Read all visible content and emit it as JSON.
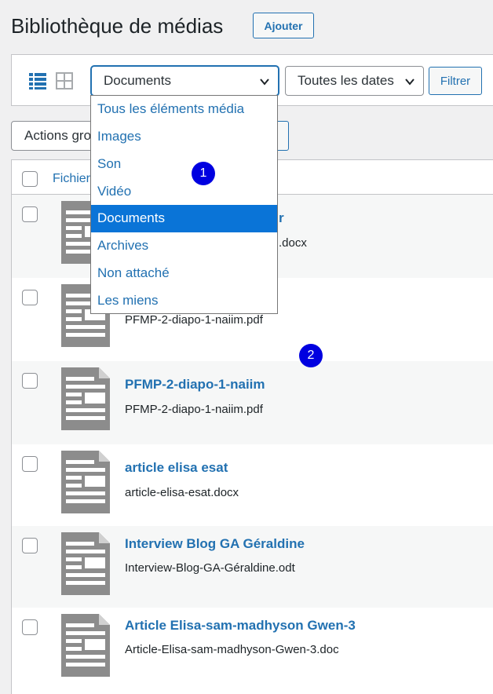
{
  "header": {
    "title": "Bibliothèque de médias",
    "add_label": "Ajouter"
  },
  "toolbar": {
    "list_view_icon": "list-view-icon",
    "grid_view_icon": "grid-view-icon",
    "type_filter_value": "Documents",
    "date_filter_value": "Toutes les dates",
    "filter_label": "Filtrer"
  },
  "bulk": {
    "actions_label": "Actions groupées"
  },
  "table": {
    "file_column": "Fichier"
  },
  "dropdown": {
    "options": [
      "Tous les éléments média",
      "Images",
      "Son",
      "Vidéo",
      "Documents",
      "Archives",
      "Non attaché",
      "Les miens"
    ],
    "selected": "Documents"
  },
  "rows": [
    {
      "title": "r",
      "file": ".docx"
    },
    {
      "title": "",
      "file": "PFMP-2-diapo-1-naiim.pdf"
    },
    {
      "title": "PFMP-2-diapo-1-naiim",
      "file": "PFMP-2-diapo-1-naiim.pdf"
    },
    {
      "title": "article elisa esat",
      "file": "article-elisa-esat.docx"
    },
    {
      "title": "Interview Blog GA Géraldine",
      "file": "Interview-Blog-GA-Géraldine.odt"
    },
    {
      "title": "Article Elisa-sam-madhyson Gwen-3",
      "file": "Article-Elisa-sam-madhyson-Gwen-3.doc"
    }
  ],
  "markers": [
    "1",
    "2"
  ],
  "colors": {
    "accent": "#2271b1",
    "selected_option": "#0a74d7",
    "marker": "#0000e0"
  }
}
